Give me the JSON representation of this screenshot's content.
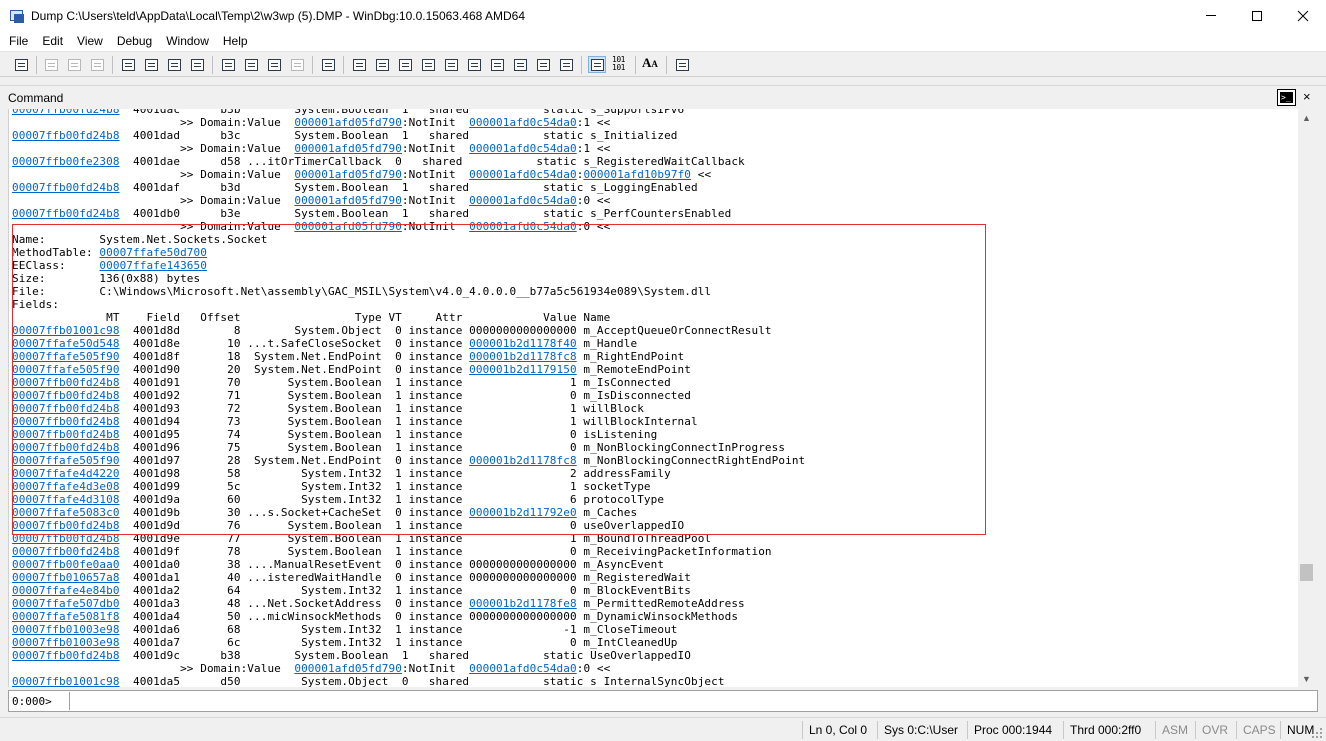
{
  "window": {
    "title": "Dump C:\\Users\\teld\\AppData\\Local\\Temp\\2\\w3wp (5).DMP - WinDbg:10.0.15063.468 AMD64"
  },
  "menu": [
    "File",
    "Edit",
    "View",
    "Debug",
    "Window",
    "Help"
  ],
  "toolbar": {
    "bits_label_top": "101",
    "bits_label_bottom": "101",
    "font_label": "A",
    "font_label_small": "A"
  },
  "command_panel": {
    "title": "Command",
    "close_glyph": "×"
  },
  "output_lines": [
    [
      {
        "t": "00007ffb00fd24b8",
        "link": true
      },
      {
        "t": "  4001dac      b3b        System.Boolean  1   shared           static s_SupportsIPv6"
      }
    ],
    [
      {
        "t": "                         >> Domain:Value  "
      },
      {
        "t": "000001afd05fd790",
        "link": true
      },
      {
        "t": ":NotInit  "
      },
      {
        "t": "000001afd0c54da0",
        "link": true
      },
      {
        "t": ":1 <<"
      }
    ],
    [
      {
        "t": "00007ffb00fd24b8",
        "link": true
      },
      {
        "t": "  4001dad      b3c        System.Boolean  1   shared           static s_Initialized"
      }
    ],
    [
      {
        "t": "                         >> Domain:Value  "
      },
      {
        "t": "000001afd05fd790",
        "link": true
      },
      {
        "t": ":NotInit  "
      },
      {
        "t": "000001afd0c54da0",
        "link": true
      },
      {
        "t": ":1 <<"
      }
    ],
    [
      {
        "t": "00007ffb00fe2308",
        "link": true
      },
      {
        "t": "  4001dae      d58 ...itOrTimerCallback  0   shared           static s_RegisteredWaitCallback"
      }
    ],
    [
      {
        "t": "                         >> Domain:Value  "
      },
      {
        "t": "000001afd05fd790",
        "link": true
      },
      {
        "t": ":NotInit  "
      },
      {
        "t": "000001afd0c54da0",
        "link": true
      },
      {
        "t": ":"
      },
      {
        "t": "000001afd10b97f0",
        "link": true
      },
      {
        "t": " <<"
      }
    ],
    [
      {
        "t": "00007ffb00fd24b8",
        "link": true
      },
      {
        "t": "  4001daf      b3d        System.Boolean  1   shared           static s_LoggingEnabled"
      }
    ],
    [
      {
        "t": "                         >> Domain:Value  "
      },
      {
        "t": "000001afd05fd790",
        "link": true
      },
      {
        "t": ":NotInit  "
      },
      {
        "t": "000001afd0c54da0",
        "link": true
      },
      {
        "t": ":0 <<"
      }
    ],
    [
      {
        "t": "00007ffb00fd24b8",
        "link": true
      },
      {
        "t": "  4001db0      b3e        System.Boolean  1   shared           static s_PerfCountersEnabled"
      }
    ],
    [
      {
        "t": "                         >> Domain:Value  "
      },
      {
        "t": "000001afd05fd790",
        "link": true
      },
      {
        "t": ":NotInit  "
      },
      {
        "t": "000001afd0c54da0",
        "link": true
      },
      {
        "t": ":0 <<"
      }
    ],
    [
      {
        "t": "Name:        System.Net.Sockets.Socket"
      }
    ],
    [
      {
        "t": "MethodTable: "
      },
      {
        "t": "00007ffafe50d700",
        "link": true
      }
    ],
    [
      {
        "t": "EEClass:     "
      },
      {
        "t": "00007ffafe143650",
        "link": true
      }
    ],
    [
      {
        "t": "Size:        136(0x88) bytes"
      }
    ],
    [
      {
        "t": "File:        C:\\Windows\\Microsoft.Net\\assembly\\GAC_MSIL\\System\\v4.0_4.0.0.0__b77a5c561934e089\\System.dll"
      }
    ],
    [
      {
        "t": "Fields:"
      }
    ],
    [
      {
        "t": "              MT    Field   Offset                 Type VT     Attr            Value Name"
      }
    ],
    [
      {
        "t": "00007ffb01001c98",
        "link": true
      },
      {
        "t": "  4001d8d        8        System.Object  0 instance 0000000000000000 m_AcceptQueueOrConnectResult"
      }
    ],
    [
      {
        "t": "00007ffafe50d548",
        "link": true
      },
      {
        "t": "  4001d8e       10 ...t.SafeCloseSocket  0 instance "
      },
      {
        "t": "000001b2d1178f40",
        "link": true
      },
      {
        "t": " m_Handle"
      }
    ],
    [
      {
        "t": "00007ffafe505f90",
        "link": true
      },
      {
        "t": "  4001d8f       18  System.Net.EndPoint  0 instance "
      },
      {
        "t": "000001b2d1178fc8",
        "link": true
      },
      {
        "t": " m_RightEndPoint"
      }
    ],
    [
      {
        "t": "00007ffafe505f90",
        "link": true
      },
      {
        "t": "  4001d90       20  System.Net.EndPoint  0 instance "
      },
      {
        "t": "000001b2d1179150",
        "link": true
      },
      {
        "t": " m_RemoteEndPoint"
      }
    ],
    [
      {
        "t": "00007ffb00fd24b8",
        "link": true
      },
      {
        "t": "  4001d91       70       System.Boolean  1 instance                1 m_IsConnected"
      }
    ],
    [
      {
        "t": "00007ffb00fd24b8",
        "link": true
      },
      {
        "t": "  4001d92       71       System.Boolean  1 instance                0 m_IsDisconnected"
      }
    ],
    [
      {
        "t": "00007ffb00fd24b8",
        "link": true
      },
      {
        "t": "  4001d93       72       System.Boolean  1 instance                1 willBlock"
      }
    ],
    [
      {
        "t": "00007ffb00fd24b8",
        "link": true
      },
      {
        "t": "  4001d94       73       System.Boolean  1 instance                1 willBlockInternal"
      }
    ],
    [
      {
        "t": "00007ffb00fd24b8",
        "link": true
      },
      {
        "t": "  4001d95       74       System.Boolean  1 instance                0 isListening"
      }
    ],
    [
      {
        "t": "00007ffb00fd24b8",
        "link": true
      },
      {
        "t": "  4001d96       75       System.Boolean  1 instance                0 m_NonBlockingConnectInProgress"
      }
    ],
    [
      {
        "t": "00007ffafe505f90",
        "link": true
      },
      {
        "t": "  4001d97       28  System.Net.EndPoint  0 instance "
      },
      {
        "t": "000001b2d1178fc8",
        "link": true
      },
      {
        "t": " m_NonBlockingConnectRightEndPoint"
      }
    ],
    [
      {
        "t": "00007ffafe4d4220",
        "link": true
      },
      {
        "t": "  4001d98       58         System.Int32  1 instance                2 addressFamily"
      }
    ],
    [
      {
        "t": "00007ffafe4d3e08",
        "link": true
      },
      {
        "t": "  4001d99       5c         System.Int32  1 instance                1 socketType"
      }
    ],
    [
      {
        "t": "00007ffafe4d3108",
        "link": true
      },
      {
        "t": "  4001d9a       60         System.Int32  1 instance                6 protocolType"
      }
    ],
    [
      {
        "t": "00007ffafe5083c0",
        "link": true
      },
      {
        "t": "  4001d9b       30 ...s.Socket+CacheSet  0 instance "
      },
      {
        "t": "000001b2d11792e0",
        "link": true
      },
      {
        "t": " m_Caches"
      }
    ],
    [
      {
        "t": "00007ffb00fd24b8",
        "link": true
      },
      {
        "t": "  4001d9d       76       System.Boolean  1 instance                0 useOverlappedIO"
      }
    ],
    [
      {
        "t": "00007ffb00fd24b8",
        "link": true
      },
      {
        "t": "  4001d9e       77       System.Boolean  1 instance                1 m_BoundToThreadPool"
      }
    ],
    [
      {
        "t": "00007ffb00fd24b8",
        "link": true
      },
      {
        "t": "  4001d9f       78       System.Boolean  1 instance                0 m_ReceivingPacketInformation"
      }
    ],
    [
      {
        "t": "00007ffb00fe0aa0",
        "link": true
      },
      {
        "t": "  4001da0       38 ....ManualResetEvent  0 instance 0000000000000000 m_AsyncEvent"
      }
    ],
    [
      {
        "t": "00007ffb010657a8",
        "link": true
      },
      {
        "t": "  4001da1       40 ...isteredWaitHandle  0 instance 0000000000000000 m_RegisteredWait"
      }
    ],
    [
      {
        "t": "00007ffafe4e84b0",
        "link": true
      },
      {
        "t": "  4001da2       64         System.Int32  1 instance                0 m_BlockEventBits"
      }
    ],
    [
      {
        "t": "00007ffafe507db0",
        "link": true
      },
      {
        "t": "  4001da3       48 ...Net.SocketAddress  0 instance "
      },
      {
        "t": "000001b2d1178fe8",
        "link": true
      },
      {
        "t": " m_PermittedRemoteAddress"
      }
    ],
    [
      {
        "t": "00007ffafe5081f8",
        "link": true
      },
      {
        "t": "  4001da4       50 ...micWinsockMethods  0 instance 0000000000000000 m_DynamicWinsockMethods"
      }
    ],
    [
      {
        "t": "00007ffb01003e98",
        "link": true
      },
      {
        "t": "  4001da6       68         System.Int32  1 instance               -1 m_CloseTimeout"
      }
    ],
    [
      {
        "t": "00007ffb01003e98",
        "link": true
      },
      {
        "t": "  4001da7       6c         System.Int32  1 instance                0 m_IntCleanedUp"
      }
    ],
    [
      {
        "t": "00007ffb00fd24b8",
        "link": true
      },
      {
        "t": "  4001d9c      b38        System.Boolean  1   shared           static UseOverlappedIO"
      }
    ],
    [
      {
        "t": "                         >> Domain:Value  "
      },
      {
        "t": "000001afd05fd790",
        "link": true
      },
      {
        "t": ":NotInit  "
      },
      {
        "t": "000001afd0c54da0",
        "link": true
      },
      {
        "t": ":0 <<"
      }
    ],
    [
      {
        "t": "00007ffb01001c98",
        "link": true
      },
      {
        "t": "  4001da5      d50         System.Object  0   shared           static s_InternalSyncObject"
      }
    ]
  ],
  "input": {
    "prompt": "0:000>",
    "value": ""
  },
  "status": {
    "cursor": "Ln 0, Col 0",
    "sys": "Sys 0:C:\\User",
    "proc": "Proc 000:1944",
    "thrd": "Thrd 000:2ff0",
    "asm": "ASM",
    "ovr": "OVR",
    "caps": "CAPS",
    "num": "NUM"
  }
}
